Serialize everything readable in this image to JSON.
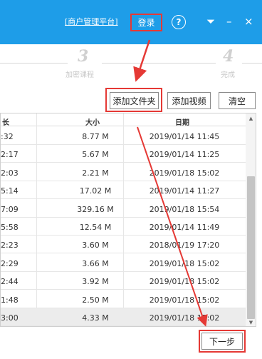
{
  "titlebar": {
    "admin_link": "[商户管理平台]",
    "login_label": "登录",
    "help_icon": "?",
    "dropdown_icon": "⏷",
    "minimize_icon": "–",
    "close_icon": "×"
  },
  "steps": [
    {
      "num": "3",
      "label": "加密课程"
    },
    {
      "num": "4",
      "label": "完成"
    }
  ],
  "toolbar": {
    "add_folder": "添加文件夹",
    "add_video": "添加视频",
    "clear": "清空"
  },
  "table": {
    "headers": {
      "duration": "长",
      "size": "大小",
      "date": "日期"
    },
    "rows": [
      {
        "duration": ":32",
        "size": "8.77 M",
        "date": "2019/01/14 11:45"
      },
      {
        "duration": "2:17",
        "size": "5.67 M",
        "date": "2019/01/14 11:25"
      },
      {
        "duration": "2:03",
        "size": "2.21 M",
        "date": "2019/01/18 15:02"
      },
      {
        "duration": "5:14",
        "size": "17.02 M",
        "date": "2019/01/14 11:27"
      },
      {
        "duration": "7:09",
        "size": "329.16 M",
        "date": "2019/01/18 15:54"
      },
      {
        "duration": "5:58",
        "size": "12.54 M",
        "date": "2019/01/14 11:49"
      },
      {
        "duration": "2:23",
        "size": "3.60 M",
        "date": "2018/01/19 17:20"
      },
      {
        "duration": "2:29",
        "size": "3.66 M",
        "date": "2019/01/18 15:02"
      },
      {
        "duration": "2:44",
        "size": "3.92 M",
        "date": "2019/01/18 15:02"
      },
      {
        "duration": "1:48",
        "size": "2.50 M",
        "date": "2019/01/18 15:02"
      },
      {
        "duration": "3:00",
        "size": "4.33 M",
        "date": "2019/01/18 15:02"
      }
    ]
  },
  "next_label": "下一步",
  "colors": {
    "titlebar": "#1e9de8",
    "highlight": "#e53935",
    "selected_row": "#ececec"
  }
}
